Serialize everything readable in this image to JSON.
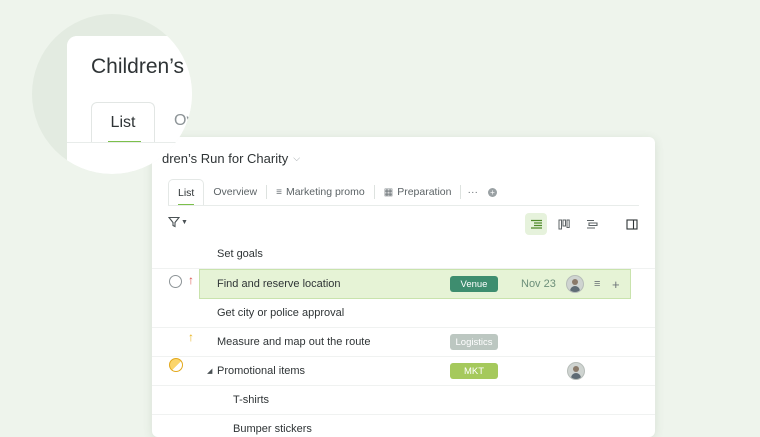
{
  "project": {
    "title": "dren’s Run for Charity"
  },
  "tabs": [
    {
      "label": "List"
    },
    {
      "label": "Overview"
    },
    {
      "label": "Marketing promo"
    },
    {
      "label": "Preparation"
    }
  ],
  "more_label": "···",
  "magnifier": {
    "title": "Children’s",
    "tab_active": "List",
    "tab_next": "Ov"
  },
  "rows": [
    {
      "name": "Set goals"
    },
    {
      "name": "Find and reserve location",
      "tag": "Venue",
      "tag_color": "#3e8d6f",
      "date": "Nov 23",
      "priority": "red",
      "status": "open"
    },
    {
      "name": "Get city or police approval"
    },
    {
      "name": "Measure and map out the route",
      "tag": "Logistics",
      "tag_color": "#bcc7c1",
      "priority": "yellow"
    },
    {
      "name": "Promotional items",
      "tag": "MKT",
      "tag_color": "#a5c95c",
      "status": "half",
      "expanded": true
    },
    {
      "name": "T-shirts"
    },
    {
      "name": "Bumper stickers"
    }
  ],
  "colors": {
    "background": "#eef4ec",
    "accent": "#7cc04b",
    "highlight_row": "#e6f3d6"
  }
}
